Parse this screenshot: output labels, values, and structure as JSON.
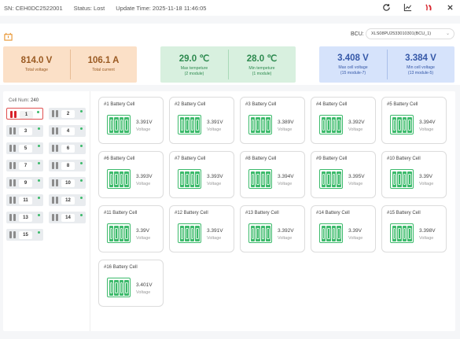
{
  "topbar": {
    "sn": "SN: CEH0DC2522001",
    "status": "Status: Lost",
    "update_time": "Update Time: 2025-11-18 11:46:05"
  },
  "bcu": {
    "label": "BCU:",
    "value": "XLS08PU2533010301(BCU_1)"
  },
  "summary": {
    "total_voltage": {
      "value": "814.0 V",
      "label": "Total voltage"
    },
    "total_current": {
      "value": "106.1 A",
      "label": "Total current"
    },
    "max_temp": {
      "value": "29.0 ℃",
      "label": "Max tempeture",
      "sub": "(2 module)"
    },
    "min_temp": {
      "value": "28.0 ℃",
      "label": "Min tempeture",
      "sub": "(1 module)"
    },
    "max_cell": {
      "value": "3.408 V",
      "label": "Max cell voltage",
      "sub": "(15 module-7)"
    },
    "min_cell": {
      "value": "3.384 V",
      "label": "Min cell voltage",
      "sub": "(13 module-5)"
    }
  },
  "cell_num": {
    "label": "Cell Num:",
    "value": "240"
  },
  "modules": [
    "1",
    "2",
    "3",
    "4",
    "5",
    "6",
    "7",
    "8",
    "9",
    "10",
    "11",
    "12",
    "13",
    "14",
    "15"
  ],
  "cells": [
    {
      "title": "#1 Battery Cell",
      "voltage": "3.391V",
      "label": "Voltage"
    },
    {
      "title": "#2 Battery Cell",
      "voltage": "3.391V",
      "label": "Voltage"
    },
    {
      "title": "#3 Battery Cell",
      "voltage": "3.389V",
      "label": "Voltage"
    },
    {
      "title": "#4 Battery Cell",
      "voltage": "3.392V",
      "label": "Voltage"
    },
    {
      "title": "#5 Battery Cell",
      "voltage": "3.394V",
      "label": "Voltage"
    },
    {
      "title": "#6 Battery Cell",
      "voltage": "3.393V",
      "label": "Voltage"
    },
    {
      "title": "#7 Battery Cell",
      "voltage": "3.393V",
      "label": "Voltage"
    },
    {
      "title": "#8 Battery Cell",
      "voltage": "3.394V",
      "label": "Voltage"
    },
    {
      "title": "#9 Battery Cell",
      "voltage": "3.395V",
      "label": "Voltage"
    },
    {
      "title": "#10 Battery Cell",
      "voltage": "3.39V",
      "label": "Voltage"
    },
    {
      "title": "#11 Battery Cell",
      "voltage": "3.39V",
      "label": "Voltage"
    },
    {
      "title": "#12 Battery Cell",
      "voltage": "3.391V",
      "label": "Voltage"
    },
    {
      "title": "#13 Battery Cell",
      "voltage": "3.392V",
      "label": "Voltage"
    },
    {
      "title": "#14 Battery Cell",
      "voltage": "3.39V",
      "label": "Voltage"
    },
    {
      "title": "#15 Battery Cell",
      "voltage": "3.398V",
      "label": "Voltage"
    },
    {
      "title": "#16 Battery Cell",
      "voltage": "3.401V",
      "label": "Voltage"
    }
  ],
  "icons": [
    "refresh-icon",
    "chart-icon",
    "flag-icon",
    "close-icon",
    "alert-icon",
    "battery-icon"
  ],
  "colors": {
    "accent_red": "#d8222b",
    "ok_green": "#3cba6b"
  }
}
